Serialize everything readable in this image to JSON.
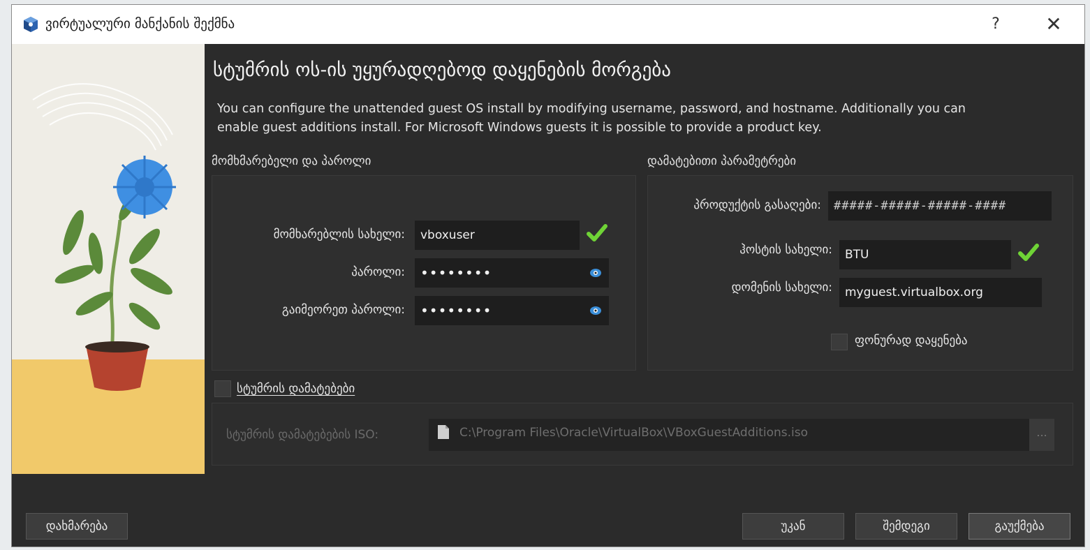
{
  "window": {
    "title": "ვირტუალური მანქანის შექმნა",
    "help_label": "?",
    "close_label": "✕"
  },
  "page": {
    "title": "სტუმრის ოს-ის უყურადღებოდ დაყენების მორგება",
    "description": "You can configure the unattended guest OS install by modifying username, password, and hostname. Additionally you can enable guest additions install. For Microsoft Windows guests it is possible to provide a product key."
  },
  "user_group": {
    "label": "მომხმარებელი და პაროლი",
    "username_label": "მომხარებლის სახელი:",
    "username_value": "vboxuser",
    "password_label": "პაროლი:",
    "password_value": "••••••••",
    "repeat_password_label": "გაიმეორეთ პაროლი:",
    "repeat_password_value": "••••••••"
  },
  "additional_group": {
    "label": "დამატებითი პარამეტრები",
    "product_key_label": "პროდუქტის გასაღები:",
    "product_key_value": "#####-#####-#####-####",
    "hostname_label": "ჰოსტის სახელი:",
    "hostname_value": "BTU",
    "domain_label": "დომენის სახელი:",
    "domain_value": "myguest.virtualbox.org",
    "background_install_label": "ფონურად დაყენება"
  },
  "guest_additions": {
    "checkbox_label": "სტუმრის დამატებები",
    "iso_label": "სტუმრის დამატებების ISO:",
    "iso_path": "C:\\Program Files\\Oracle\\VirtualBox\\VBoxGuestAdditions.iso",
    "iso_button_label": "..."
  },
  "footer": {
    "help_label": "დახმარება",
    "back_label": "უკან",
    "next_label": "შემდეგი",
    "cancel_label": "გაუქმება"
  },
  "icons": {
    "window_icon": "virtualbox-cube-icon",
    "eye_icon": "eye-icon",
    "valid_icon": "green-check-icon",
    "file_icon": "file-icon"
  },
  "colors": {
    "dialog_bg": "#2b2b2b",
    "field_bg": "#1e1e1e",
    "check_green": "#6fd336",
    "eye_blue": "#3b8fd9"
  }
}
